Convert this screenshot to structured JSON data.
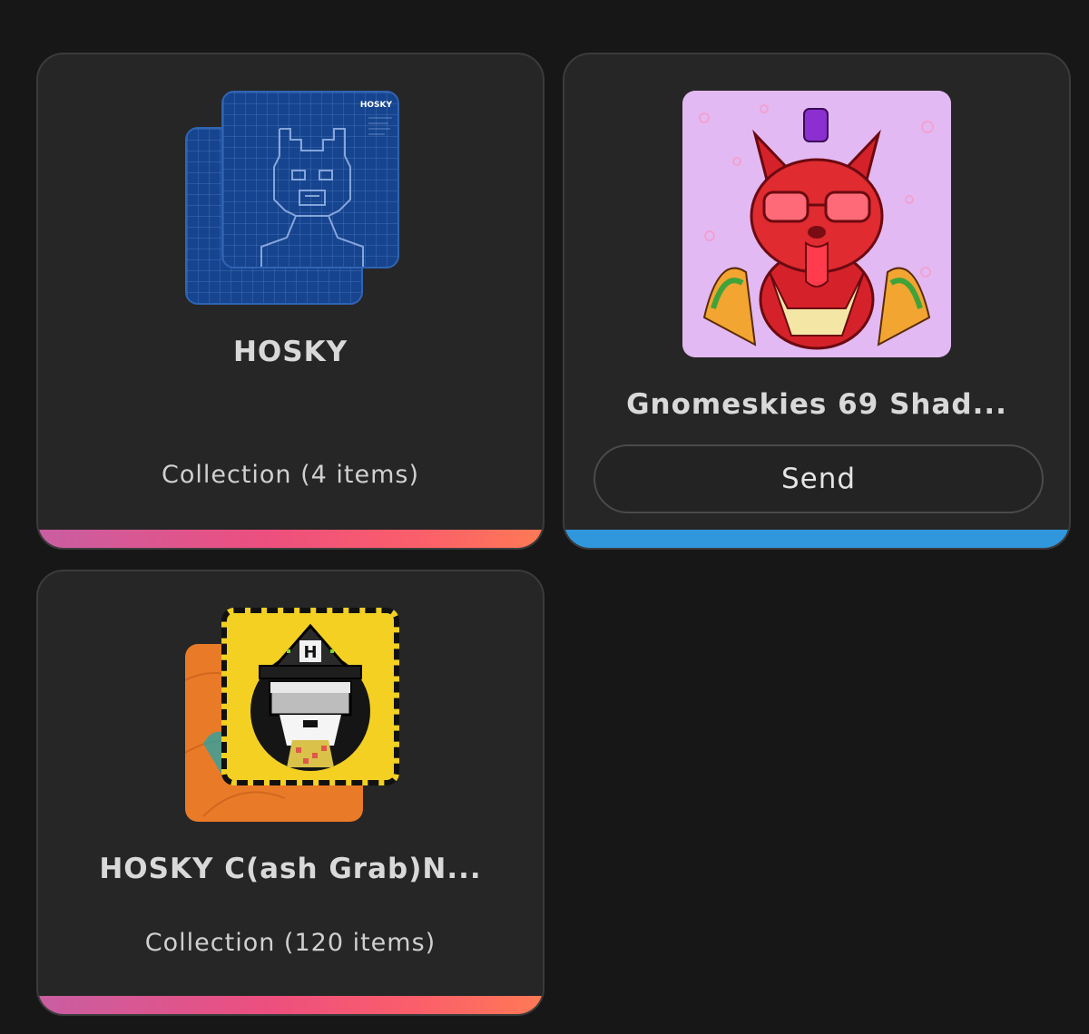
{
  "cards": [
    {
      "title": "HOSKY",
      "subtitle": "Collection (4 items)",
      "thumbnail": "hosky-blueprint-stack",
      "thumbnail_watermark": "HOSKY",
      "accent": "gradient"
    },
    {
      "title": "Gnomeskies 69 Shad...",
      "action_label": "Send",
      "thumbnail": "gnome-red-cat",
      "accent": "#3197dd"
    },
    {
      "title": "HOSKY C(ash Grab)N...",
      "subtitle": "Collection (120 items)",
      "thumbnail": "hosky-cash-grab-stack",
      "thumbnail_badge": "H",
      "accent": "gradient"
    }
  ],
  "colors": {
    "background": "#171717",
    "card": "#262626",
    "gradient_start": "#c95ea2",
    "gradient_end": "#ff7a55",
    "blue_accent": "#3197dd"
  }
}
